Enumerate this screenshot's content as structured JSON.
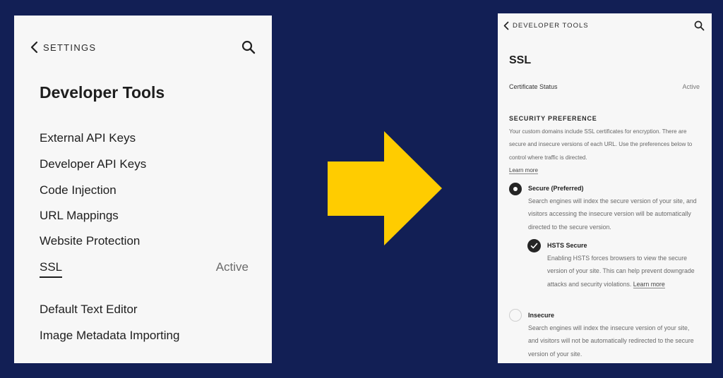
{
  "left_panel": {
    "back_label": "SETTINGS",
    "title": "Developer Tools",
    "menu_items": [
      {
        "label": "External API Keys"
      },
      {
        "label": "Developer API Keys"
      },
      {
        "label": "Code Injection"
      },
      {
        "label": "URL Mappings"
      },
      {
        "label": "Website Protection"
      },
      {
        "label": "SSL",
        "status": "Active",
        "selected": true
      },
      {
        "label": "Default Text Editor"
      },
      {
        "label": "Image Metadata Importing"
      }
    ]
  },
  "right_panel": {
    "back_label": "DEVELOPER TOOLS",
    "title": "SSL",
    "certificate": {
      "label": "Certificate Status",
      "value": "Active"
    },
    "security_preference": {
      "heading": "SECURITY PREFERENCE",
      "description": "Your custom domains include SSL certificates for encryption. There are secure and insecure versions of each URL. Use the preferences below to control where traffic is directed.",
      "learn_more": "Learn more",
      "options": [
        {
          "title": "Secure (Preferred)",
          "description": "Search engines will index the secure version of your site, and visitors accessing the insecure version will be automatically directed to the secure version.",
          "selected": true
        },
        {
          "title": "Insecure",
          "description": "Search engines will index the insecure version of your site, and visitors will not be automatically redirected to the secure version of your site.",
          "selected": false
        }
      ],
      "hsts": {
        "title": "HSTS Secure",
        "description": "Enabling HSTS forces browsers to view the secure version of your site. This can help prevent downgrade attacks and security violations.",
        "learn_more": "Learn more",
        "checked": true
      }
    }
  },
  "icons": {
    "back": "chevron-left-icon",
    "search": "search-icon",
    "arrow": "arrow-right-icon",
    "check": "check-icon"
  },
  "colors": {
    "background": "#121f55",
    "panel": "#f7f7f7",
    "arrow": "#ffcc00",
    "text": "#1e1e1e",
    "muted": "#6b6b6b"
  }
}
